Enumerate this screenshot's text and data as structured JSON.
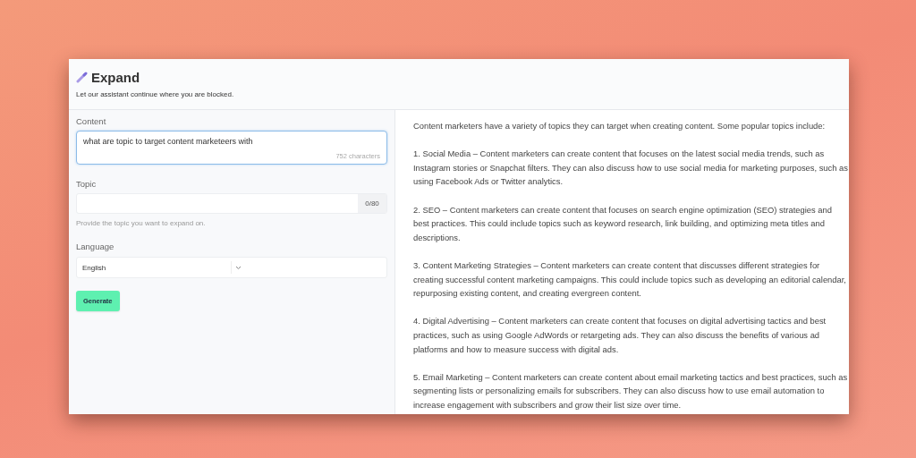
{
  "header": {
    "title": "Expand",
    "subtitle": "Let our assistant continue where you are blocked."
  },
  "form": {
    "content": {
      "label": "Content",
      "value": "what are topic to target content marketeers with",
      "counter": "752 characters",
      "focused": true
    },
    "topic": {
      "label": "Topic",
      "counter": "0/80",
      "help": "Provide the topic you want to expand on."
    },
    "language": {
      "label": "Language",
      "value": "English"
    },
    "button": "Generate"
  },
  "output": {
    "paragraphs": [
      "Content marketers have a variety of topics they can target when creating content. Some popular topics include:",
      "1. Social Media – Content marketers can create content that focuses on the latest social media trends, such as Instagram stories or Snapchat filters. They can also discuss how to use social media for marketing purposes, such as using Facebook Ads or Twitter analytics.",
      "2. SEO – Content marketers can create content that focuses on search engine optimization (SEO) strategies and best practices. This could include topics such as keyword research, link building, and optimizing meta titles and descriptions.",
      "3. Content Marketing Strategies – Content marketers can create content that discusses different strategies for creating successful content marketing campaigns. This could include topics such as developing an editorial calendar, repurposing existing content, and creating evergreen content.",
      "4. Digital Advertising – Content marketers can create content that focuses on digital advertising tactics and best practices, such as using Google AdWords or retargeting ads. They can also discuss the benefits of various ad platforms and how to measure success with digital ads.",
      "5. Email Marketing – Content marketers can create content about email marketing tactics and best practices, such as segmenting lists or personalizing emails for subscribers. They can also discuss how to use email automation to increase engagement with subscribers and grow their list size over time."
    ]
  }
}
